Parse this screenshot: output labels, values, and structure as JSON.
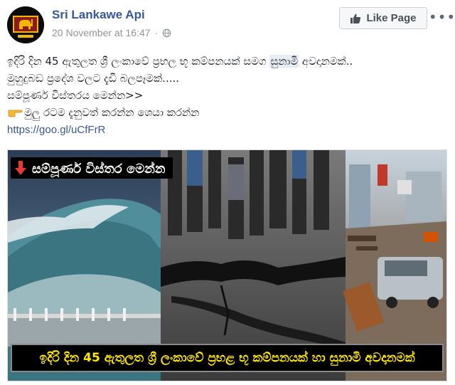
{
  "post": {
    "page_name": "Sri Lankawe Api",
    "timestamp": "20 November at 16:47",
    "separator": "·",
    "like_page_label": "Like Page",
    "more_label": "•••",
    "text_lines": {
      "line1_before": "ඉදිරි දින 45 ඇතුලත ශ්‍රී ලංකාවේ ප්‍රභල භූ කම්පනයක් සමග ",
      "line1_highlight": "සුනාමි",
      "line1_after": " අවදානමක්..",
      "line2": "මුහුදුබඩ ප්‍රදේශ වලට දැඩි බලපෑමක්.....",
      "line3": "සම්පූර්ණ විස්තරය මෙන්න>>",
      "line4": "මුලු රටම දැනුවත් කරන්න ශෙයා කරන්න",
      "link": "https://goo.gl/uCfFrR"
    },
    "image": {
      "top_banner": "සම්පූර්ණ විස්තර මෙන්න",
      "bottom_banner": "ඉදිරි දින 45 ඇතුලත ශ්‍රී ලංකාවේ ප්‍රභළ භූ කම්පනයක් හා සුනාමි අවදානමක්"
    }
  },
  "icons": {
    "avatar": "lion-flag-logo",
    "globe": "globe-icon",
    "thumb": "thumbs-up-icon",
    "point": "pointing-finger-emoji",
    "arrow": "down-arrow-icon"
  },
  "colors": {
    "page_name": "#365899",
    "link": "#385898",
    "banner_text": "#ffe600",
    "banner_bg": "#000000"
  }
}
